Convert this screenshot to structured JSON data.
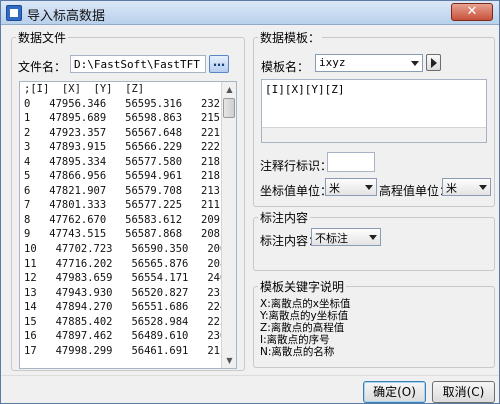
{
  "window": {
    "title": "导入标高数据",
    "close_glyph": "✕"
  },
  "data_file": {
    "group_title": "数据文件",
    "filename_label": "文件名：",
    "filename_value": "D:\\FastSoft\\FastTFT V12.",
    "browse_label": "…",
    "rows": [
      ";[I]  [X]  [Y]  [Z]",
      "0   47956.346   56595.316   232.700",
      "1   47895.689   56598.863   215.300",
      "2   47923.357   56567.648   221.700",
      "3   47893.915   56566.229   222.700",
      "4   47895.334   56577.580   218.800",
      "5   47866.956   56594.961   218.000",
      "6   47821.907   56579.708   213.300",
      "7   47801.333   56577.225   211.500",
      "8   47762.670   56583.612   209.300",
      "9   47743.515   56587.868   208.500",
      "10   47702.723   56590.350   206.900",
      "11   47716.202   56565.876   208.600",
      "12   47983.659   56554.171   240.500",
      "13   47943.930   56520.827   235.300",
      "14   47894.270   56551.686   224.200",
      "15   47885.402   56528.984   225.800",
      "16   47897.462   56489.610   230.500",
      "17   47998.299   56461.691   211.400"
    ]
  },
  "template": {
    "group_title": "数据模板：",
    "name_label": "模板名：",
    "name_value": "ixyz",
    "format_text": "[I][X][Y][Z]",
    "comment_label": "注释行标识：",
    "comment_value": "",
    "coord_unit_label": "坐标值单位：",
    "coord_unit_value": "米",
    "elev_unit_label": "高程值单位：",
    "elev_unit_value": "米"
  },
  "annotation": {
    "group_title": "标注内容",
    "content_label": "标注内容：",
    "content_value": "不标注"
  },
  "keywords": {
    "group_title": "模板关键字说明",
    "lines": [
      "X:离散点的x坐标值",
      "Y:离散点的y坐标值",
      "Z:离散点的高程值",
      "I:离散点的序号",
      "N:离散点的名称"
    ]
  },
  "buttons": {
    "ok_label": "确定(O)",
    "cancel_label": "取消(C)"
  }
}
